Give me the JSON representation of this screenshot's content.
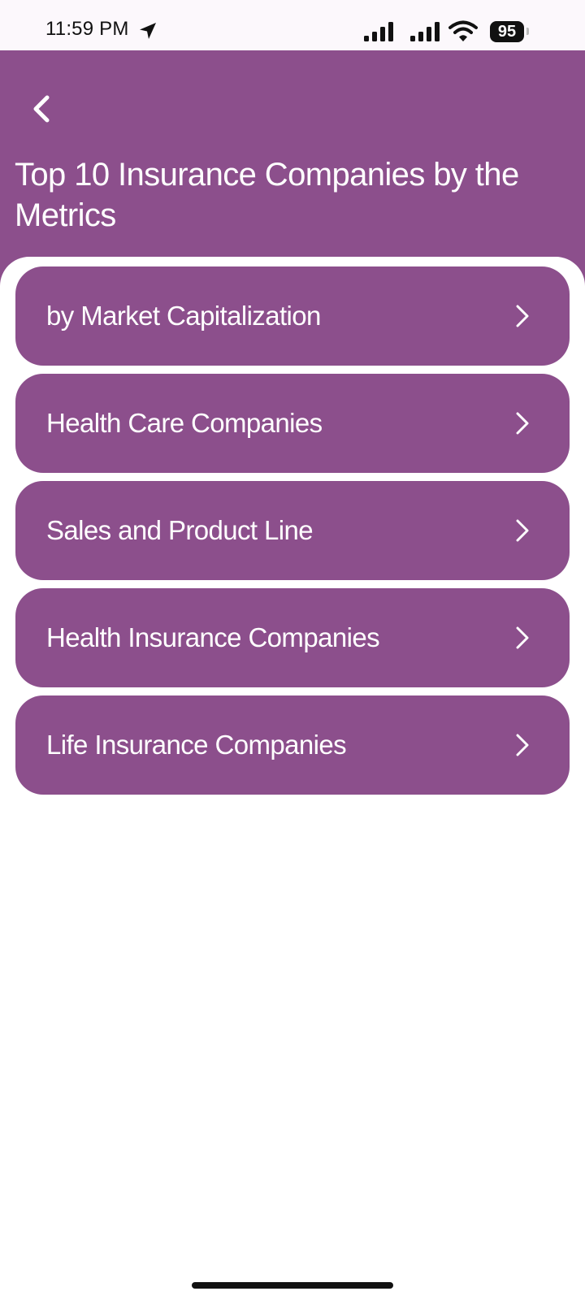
{
  "status_bar": {
    "time": "11:59 PM",
    "location_icon": "location-arrow-icon",
    "signal_icons": [
      "signal-bars-icon",
      "signal-bars-icon"
    ],
    "wifi_icon": "wifi-icon",
    "battery_level": "95"
  },
  "header": {
    "back_icon": "chevron-left-icon",
    "title": "Top 10 Insurance Companies by the Metrics"
  },
  "menu": {
    "items": [
      {
        "label": "by Market Capitalization"
      },
      {
        "label": "Health Care Companies"
      },
      {
        "label": "Sales and Product Line"
      },
      {
        "label": "Health Insurance Companies"
      },
      {
        "label": "Life Insurance Companies"
      }
    ],
    "item_icon": "chevron-right-icon"
  },
  "colors": {
    "primary": "#8c4f8c",
    "on_primary": "#ffffff",
    "background": "#ffffff",
    "status_bar": "#fcf8fc"
  }
}
